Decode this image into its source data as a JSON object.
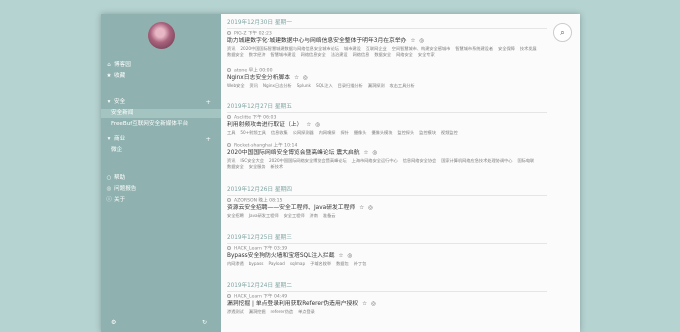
{
  "sidebar": {
    "nav": [
      {
        "icon": "home-icon",
        "glyph": "⌂",
        "label": "博客园"
      },
      {
        "icon": "star-icon",
        "glyph": "★",
        "label": "收藏"
      }
    ],
    "category_security": {
      "label": "安全",
      "plus": "+"
    },
    "security_items": [
      {
        "label": "安全新闻",
        "active": true
      },
      {
        "label": "FreeBuf互联网安全新媒体平台",
        "active": false
      }
    ],
    "category_business": {
      "label": "商业",
      "plus": "+"
    },
    "business_items": [
      {
        "label": "微企"
      }
    ],
    "bottom_nav": [
      {
        "icon": "info-icon",
        "glyph": "○",
        "label": "帮助"
      },
      {
        "icon": "users-icon",
        "glyph": "◎",
        "label": "问题报告"
      },
      {
        "icon": "about-icon",
        "glyph": "ⓘ",
        "label": "关于"
      }
    ],
    "footer": {
      "settings_glyph": "⚙",
      "refresh_glyph": "↻"
    }
  },
  "feed": {
    "groups": [
      {
        "date": "2019年12月30日 星期一",
        "posts": [
          {
            "meta": "PIG-Z  下午 02:23",
            "title": "助力城建数字化·城建数据中心与网络信息安全整体于明年3月在京举办",
            "tags": [
              "资讯",
              "2020中国国际智慧城建数据与网络信息安全城市论坛",
              "城市建设",
              "互联网企业",
              "空间智慧城市、构建安全感城市",
              "智慧城市系统建设者",
              "安全保障",
              "技术发展",
              "数据安全",
              "数字经济",
              "智慧城市建设",
              "网络信息安全",
              "法治建设",
              "网络信息",
              "数据安全",
              "网络安全",
              "安全专家"
            ]
          },
          {
            "meta": "atone  早上 00:00",
            "title": "Nginx日志安全分析脚本",
            "tags": [
              "Web安全",
              "资讯",
              "Nginx日志分析",
              "Splunk",
              "SQL注入",
              "目录扫描分析",
              "漏洞探测",
              "攻击工具分析"
            ]
          }
        ]
      },
      {
        "date": "2019年12月27日 星期五",
        "posts": [
          {
            "meta": "Asclitte  下午 06:03",
            "title": "利用射频攻击进行取证（上）",
            "tags": [
              "工具",
              "50+射频工具",
              "信息收集",
              "公网探测器",
              "内网嗅探",
              "探针",
              "摄像头",
              "摄像头模块",
              "监控探头",
              "监控模块",
              "视频监控"
            ]
          },
          {
            "meta": "Rocket-shanghai  上午 10:14",
            "title": "2020中国国际网络安全博览会暨高峰论坛 震大启航",
            "tags": [
              "资讯",
              "ISC安全大会",
              "2020中国国际网络安全博览会暨高峰论坛",
              "上海市网络安全运行中心",
              "信息网络安全协会",
              "国家计算机网络应急技术处理协调中心",
              "国际电联",
              "数据安全",
              "安全服务",
              "新技术"
            ]
          }
        ]
      },
      {
        "date": "2019年12月26日 星期四",
        "posts": [
          {
            "meta": "AZORSON  晚上 08:15",
            "title": "资源云安全招聘——安全工程师、Java研发工程师",
            "tags": [
              "安全招聘",
              "Java研发工程师",
              "安全工程师",
              "济南",
              "准备云"
            ]
          }
        ]
      },
      {
        "date": "2019年12月25日 星期三",
        "posts": [
          {
            "meta": "HACK_Learn  下午 03:39",
            "title": "Bypass安全狗防火墙和宝塔SQL注入拦截",
            "tags": [
              "内网渗透",
              "bypass",
              "Payload",
              "sqlmap",
              "子域名枚举",
              "数据包",
              "补丁包"
            ]
          }
        ]
      },
      {
        "date": "2019年12月24日 星期二",
        "posts": [
          {
            "meta": "HACK_Learn  下午 04:49",
            "title": "漏洞挖掘 | 单点登录利用获取Referer伪造用户授权",
            "tags": [
              "渗透测试",
              "漏洞挖掘",
              "referer伪造",
              "单点登录"
            ]
          }
        ]
      }
    ],
    "star_glyph": "☆",
    "share_glyph": "◎"
  },
  "search": {
    "glyph": "⌕"
  }
}
